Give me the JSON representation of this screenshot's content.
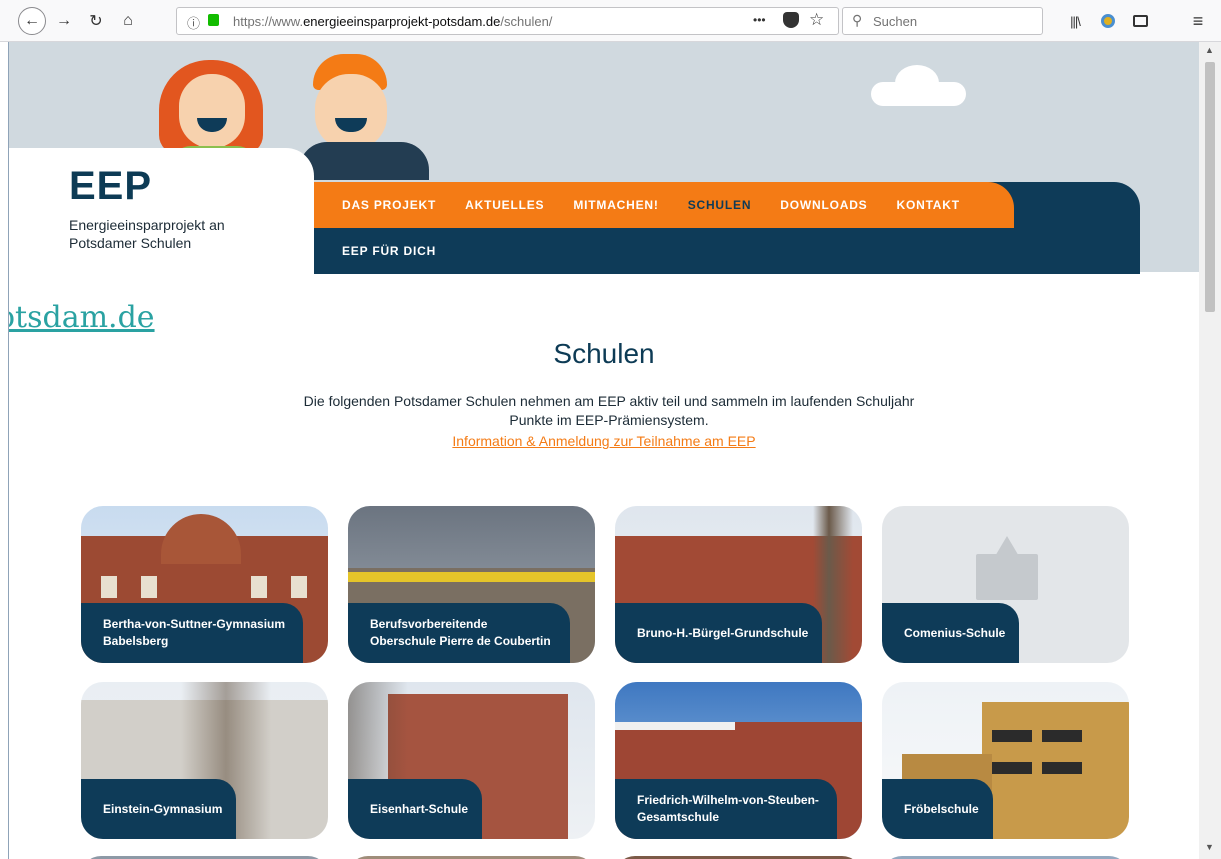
{
  "browser": {
    "url_prefix": "https://www.",
    "url_domain": "energieeinsparprojekt-potsdam.de",
    "url_path": "/schulen/",
    "search_placeholder": "Suchen",
    "menu_dots": "•••"
  },
  "site": {
    "logo": "EEP",
    "logo_subtitle": "Energieeinsparprojekt an Potsdamer Schulen",
    "overlay_link": "otsdam.de"
  },
  "nav": {
    "items": [
      "DAS PROJEKT",
      "AKTUELLES",
      "MITMACHEN!",
      "SCHULEN",
      "DOWNLOADS",
      "KONTAKT"
    ],
    "active": "SCHULEN",
    "sub_item": "EEP FÜR DICH"
  },
  "main": {
    "title": "Schulen",
    "intro": "Die folgenden Potsdamer Schulen nehmen am EEP aktiv teil und sammeln im laufenden Schuljahr Punkte im EEP-Prämiensystem.",
    "link": "Information & Anmeldung zur Teilnahme am EEP"
  },
  "schools": [
    {
      "name": "Bertha-von-Suttner-Gymnasium Babelsberg"
    },
    {
      "name": "Berufsvorbereitende Oberschule Pierre de Coubertin"
    },
    {
      "name": "Bruno-H.-Bürgel-Grundschule"
    },
    {
      "name": "Comenius-Schule"
    },
    {
      "name": "Einstein-Gymnasium"
    },
    {
      "name": "Eisenhart-Schule"
    },
    {
      "name": "Friedrich-Wilhelm-von-Steuben-Gesamtschule"
    },
    {
      "name": "Fröbelschule"
    }
  ],
  "colors": {
    "navy": "#0e3b58",
    "orange": "#f47b15",
    "hero_bg": "#d0d9df"
  }
}
